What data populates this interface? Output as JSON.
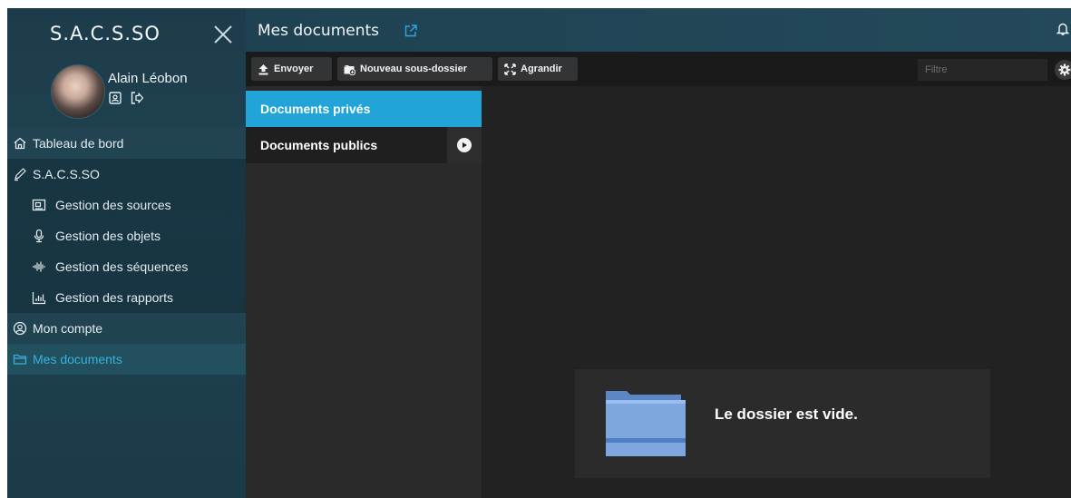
{
  "sidebar": {
    "brand": "S.A.C.S.SO",
    "user_name": "Alain Léobon",
    "nav": [
      {
        "label": "Tableau de bord",
        "icon": "home-icon"
      },
      {
        "label": "S.A.C.S.SO",
        "icon": "pen-icon"
      },
      {
        "label": "Gestion des sources",
        "icon": "sources-icon"
      },
      {
        "label": "Gestion des objets",
        "icon": "microphone-icon"
      },
      {
        "label": "Gestion des séquences",
        "icon": "waveform-icon"
      },
      {
        "label": "Gestion des rapports",
        "icon": "bar-chart-icon"
      },
      {
        "label": "Mon compte",
        "icon": "user-circle-icon"
      },
      {
        "label": "Mes documents",
        "icon": "folder-icon",
        "active": true
      }
    ]
  },
  "header": {
    "title": "Mes documents"
  },
  "toolbar": {
    "upload_label": "Envoyer",
    "new_folder_label": "Nouveau sous-dossier",
    "expand_label": "Agrandir",
    "filter_placeholder": "Filtre"
  },
  "folders": [
    {
      "label": "Documents privés",
      "selected": true
    },
    {
      "label": "Documents publics",
      "selected": false
    }
  ],
  "content": {
    "empty_message": "Le dossier est vide."
  },
  "colors": {
    "accent": "#21a4d8",
    "active_nav_text": "#35b0e0",
    "sidebar_bg": "#1f4352",
    "panel_bg": "#2a2a2a"
  }
}
